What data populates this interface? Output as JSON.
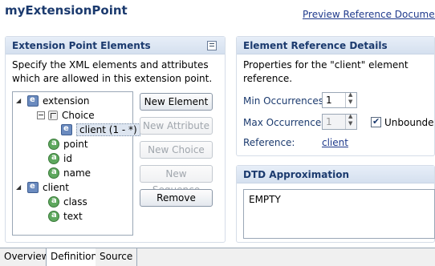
{
  "header": {
    "title": "myExtensionPoint",
    "preview_link": "Preview Reference Document"
  },
  "left_section": {
    "title": "Extension Point Elements",
    "description": "Specify the XML elements and attributes which are allowed in this extension point.",
    "tree": [
      {
        "label": "extension",
        "icon": "element-icon",
        "expanded": true
      },
      {
        "label": "Choice",
        "icon": "choice-icon",
        "expanded": true
      },
      {
        "label": "client (1 - *)",
        "icon": "element-icon",
        "selected": true
      },
      {
        "label": "point",
        "icon": "attribute-icon"
      },
      {
        "label": "id",
        "icon": "attribute-icon"
      },
      {
        "label": "name",
        "icon": "attribute-icon"
      },
      {
        "label": "client",
        "icon": "element-icon",
        "expanded": true
      },
      {
        "label": "class",
        "icon": "attribute-icon"
      },
      {
        "label": "text",
        "icon": "attribute-icon"
      }
    ],
    "buttons": {
      "new_element": "New Element",
      "new_attribute": "New Attribute",
      "new_choice": "New Choice",
      "new_sequence": "New Sequence",
      "remove": "Remove"
    }
  },
  "right_section": {
    "title": "Element Reference Details",
    "description": "Properties for the \"client\" element reference.",
    "min_label": "Min Occurrences:",
    "min_value": "1",
    "max_label": "Max Occurrences:",
    "max_value": "1",
    "unbounded_label": "Unbounde",
    "unbounded_checked": true,
    "reference_label": "Reference:",
    "reference_value": "client"
  },
  "dtd_section": {
    "title": "DTD Approximation",
    "content": "EMPTY"
  },
  "tabs": [
    {
      "label": "Overview",
      "active": false
    },
    {
      "label": "Definition",
      "active": true
    },
    {
      "label": "Source",
      "active": false
    }
  ],
  "colors": {
    "title": "#1b3a6e",
    "link": "#1f3a8c",
    "section_header": "#d5e0ef"
  }
}
